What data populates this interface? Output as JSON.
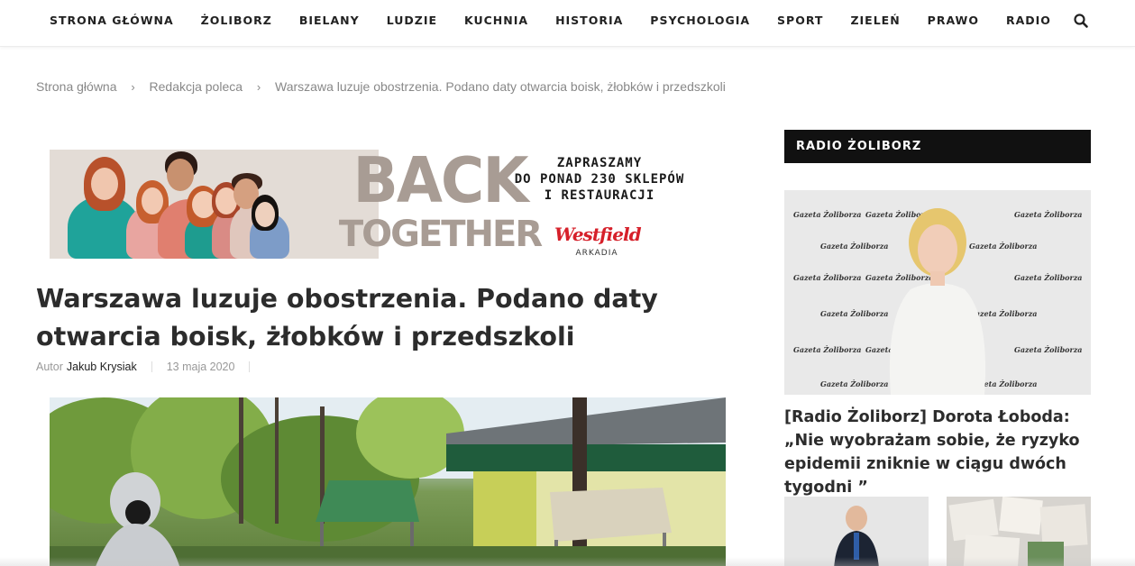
{
  "nav": {
    "items": [
      {
        "label": "STRONA GŁÓWNA"
      },
      {
        "label": "ŻOLIBORZ"
      },
      {
        "label": "BIELANY"
      },
      {
        "label": "LUDZIE"
      },
      {
        "label": "KUCHNIA"
      },
      {
        "label": "HISTORIA"
      },
      {
        "label": "PSYCHOLOGIA"
      },
      {
        "label": "SPORT"
      },
      {
        "label": "ZIELEŃ"
      },
      {
        "label": "PRAWO"
      },
      {
        "label": "RADIO"
      }
    ],
    "search_icon": "search-icon"
  },
  "breadcrumb": {
    "home": "Strona główna",
    "section": "Redakcja poleca",
    "current": "Warszawa luzuje obostrzenia. Podano daty otwarcia boisk, żłobków i przedszkoli",
    "separator": "›"
  },
  "banner": {
    "headline_1": "BACK",
    "headline_2": "TOGETHER",
    "tagline_1": "ZAPRASZAMY",
    "tagline_2": "DO PONAD 230 SKLEPÓW",
    "tagline_3": "I RESTAURACJI",
    "brand": "Westfield",
    "brand_sub": "ARKADIA"
  },
  "article": {
    "title": "Warszawa luzuje obostrzenia. Podano daty otwarcia boisk, żłobków i przedszkoli",
    "author_prefix": "Autor",
    "author": "Jakub Krysiak",
    "date": "13 maja 2020"
  },
  "sidebar": {
    "heading": "RADIO ŻOLIBORZ",
    "wall_text": "Gazeta Żoliborza",
    "featured_title": "[Radio Żoliborz] Dorota Łoboda: „Nie wyobrażam sobie, że ryzyko epidemii zniknie w ciągu dwóch tygodni ”"
  },
  "colors": {
    "nav_text": "#222222",
    "heading_bg": "#111111",
    "brand_red": "#d6202a",
    "banner_grey": "#a89c94",
    "muted": "#888888"
  }
}
